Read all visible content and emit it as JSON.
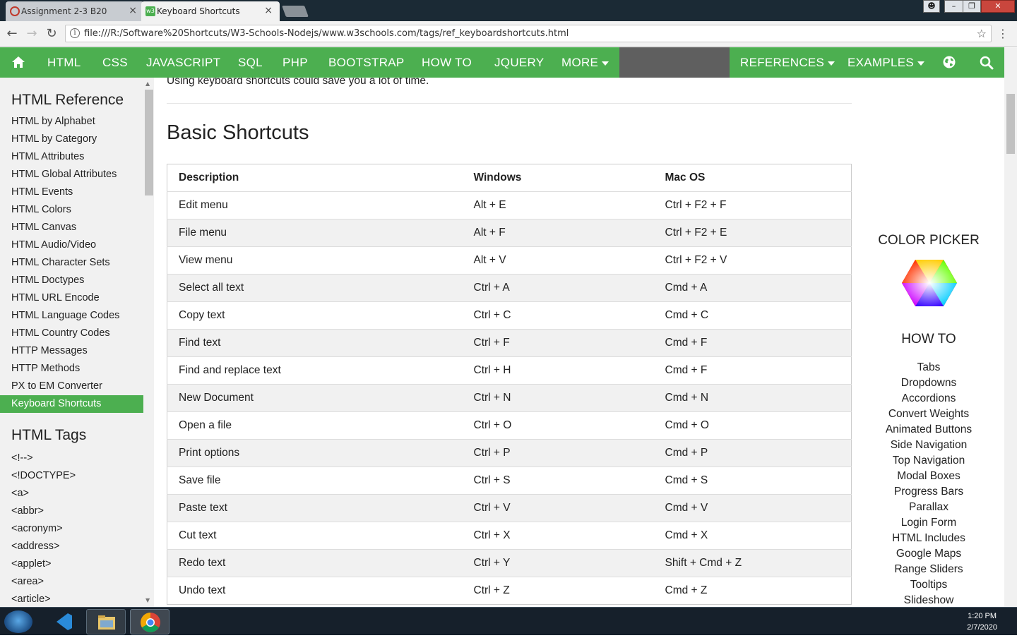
{
  "browser": {
    "tabs": [
      {
        "title": "Assignment 2-3 B20",
        "close": "×"
      },
      {
        "title": "Keyboard Shortcuts",
        "close": "×"
      }
    ],
    "url": "file:///R:/Software%20Shortcuts/W3-Schools-Nodejs/www.w3schools.com/tags/ref_keyboardshortcuts.html",
    "window_controls": [
      "minimize",
      "restore",
      "close"
    ]
  },
  "topnav": {
    "items": [
      "HTML",
      "CSS",
      "JAVASCRIPT",
      "SQL",
      "PHP",
      "BOOTSTRAP",
      "HOW TO",
      "JQUERY",
      "MORE"
    ],
    "right_items": [
      "REFERENCES",
      "EXAMPLES"
    ],
    "icons": [
      "home-icon",
      "globe-icon",
      "search-icon"
    ],
    "accent_color": "#4CAF50"
  },
  "sidebar": {
    "title1": "HTML Reference",
    "links": [
      "HTML by Alphabet",
      "HTML by Category",
      "HTML Attributes",
      "HTML Global Attributes",
      "HTML Events",
      "HTML Colors",
      "HTML Canvas",
      "HTML Audio/Video",
      "HTML Character Sets",
      "HTML Doctypes",
      "HTML URL Encode",
      "HTML Language Codes",
      "HTML Country Codes",
      "HTTP Messages",
      "HTTP Methods",
      "PX to EM Converter",
      "Keyboard Shortcuts"
    ],
    "active_link": "Keyboard Shortcuts",
    "title2": "HTML Tags",
    "tags": [
      "<!-->",
      "<!DOCTYPE>",
      "<a>",
      "<abbr>",
      "<acronym>",
      "<address>",
      "<applet>",
      "<area>",
      "<article>"
    ]
  },
  "main": {
    "intro": "Using keyboard shortcuts could save you a lot of time.",
    "heading": "Basic Shortcuts",
    "table": {
      "headers": [
        "Description",
        "Windows",
        "Mac OS"
      ],
      "rows": [
        [
          "Edit menu",
          "Alt + E",
          "Ctrl + F2 + F"
        ],
        [
          "File menu",
          "Alt + F",
          "Ctrl + F2 + E"
        ],
        [
          "View menu",
          "Alt + V",
          "Ctrl + F2 + V"
        ],
        [
          "Select all text",
          "Ctrl + A",
          "Cmd + A"
        ],
        [
          "Copy text",
          "Ctrl + C",
          "Cmd + C"
        ],
        [
          "Find text",
          "Ctrl + F",
          "Cmd + F"
        ],
        [
          "Find and replace text",
          "Ctrl + H",
          "Cmd + F"
        ],
        [
          "New Document",
          "Ctrl + N",
          "Cmd + N"
        ],
        [
          "Open a file",
          "Ctrl + O",
          "Cmd + O"
        ],
        [
          "Print options",
          "Ctrl + P",
          "Cmd + P"
        ],
        [
          "Save file",
          "Ctrl + S",
          "Cmd + S"
        ],
        [
          "Paste text",
          "Ctrl + V",
          "Cmd + V"
        ],
        [
          "Cut text",
          "Ctrl + X",
          "Cmd + X"
        ],
        [
          "Redo text",
          "Ctrl + Y",
          "Shift + Cmd + Z"
        ],
        [
          "Undo text",
          "Ctrl + Z",
          "Cmd + Z"
        ]
      ]
    }
  },
  "right": {
    "color_picker_title": "COLOR PICKER",
    "howto_title": "HOW TO",
    "howto_links": [
      "Tabs",
      "Dropdowns",
      "Accordions",
      "Convert Weights",
      "Animated Buttons",
      "Side Navigation",
      "Top Navigation",
      "Modal Boxes",
      "Progress Bars",
      "Parallax",
      "Login Form",
      "HTML Includes",
      "Google Maps",
      "Range Sliders",
      "Tooltips",
      "Slideshow"
    ]
  },
  "taskbar": {
    "time": "1:20 PM",
    "date": "2/7/2020"
  }
}
